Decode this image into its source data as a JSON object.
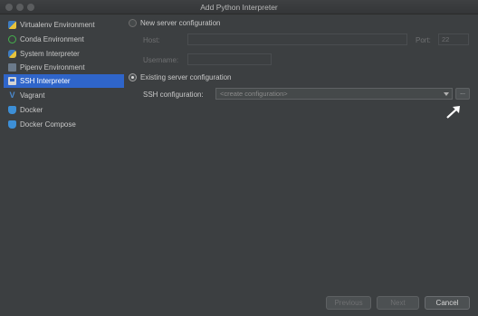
{
  "window": {
    "title": "Add Python Interpreter"
  },
  "sidebar": {
    "items": [
      {
        "label": "Virtualenv Environment",
        "icon": "virtualenv-icon",
        "selected": false
      },
      {
        "label": "Conda Environment",
        "icon": "conda-icon",
        "selected": false
      },
      {
        "label": "System Interpreter",
        "icon": "python-icon",
        "selected": false
      },
      {
        "label": "Pipenv Environment",
        "icon": "pipenv-icon",
        "selected": false
      },
      {
        "label": "SSH Interpreter",
        "icon": "ssh-icon",
        "selected": true
      },
      {
        "label": "Vagrant",
        "icon": "vagrant-icon",
        "selected": false
      },
      {
        "label": "Docker",
        "icon": "docker-icon",
        "selected": false
      },
      {
        "label": "Docker Compose",
        "icon": "docker-compose-icon",
        "selected": false
      }
    ],
    "selected_color": "#2f65ca"
  },
  "new_server": {
    "radio_label": "New server configuration",
    "host_label": "Host:",
    "host_value": "",
    "port_label": "Port:",
    "port_value": "22",
    "username_label": "Username:",
    "username_value": ""
  },
  "existing_server": {
    "radio_label": "Existing server configuration",
    "ssh_config_label": "SSH configuration:",
    "ssh_config_placeholder": "<create configuration>",
    "browse_label": "..."
  },
  "footer": {
    "previous_label": "Previous",
    "next_label": "Next",
    "cancel_label": "Cancel"
  }
}
